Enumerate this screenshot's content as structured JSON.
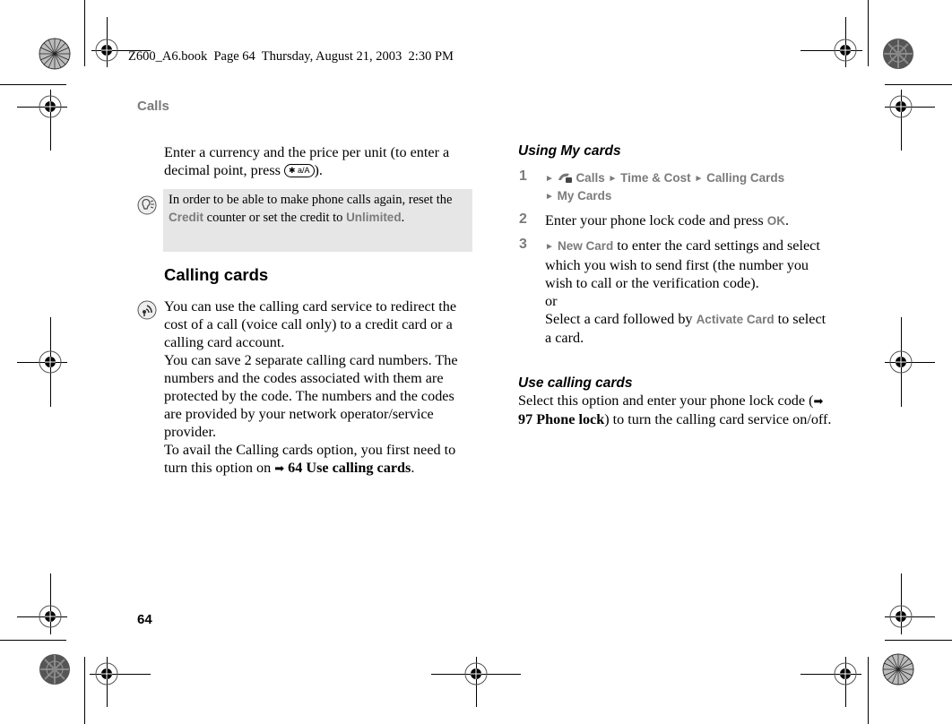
{
  "header": {
    "slug": "Z600_A6.book  Page 64  Thursday, August 21, 2003  2:30 PM",
    "running_head": "Calls"
  },
  "footer": {
    "page_number": "64"
  },
  "left_column": {
    "intro": {
      "text_before_key": "Enter a currency and the price per unit (to enter a decimal point, press ",
      "key_label": "✱ a/A",
      "text_after_key": ")."
    },
    "note": {
      "icon": "lightbulb-tip-icon",
      "text_1": "In order to be able to make phone calls again, reset the ",
      "menu_1": "Credit",
      "text_2": " counter or set the credit to ",
      "menu_2": "Unlimited",
      "text_3": "."
    },
    "heading": "Calling cards",
    "service": {
      "icon": "network-service-icon",
      "text_1": "You can use the calling card service to redirect the cost of a call (voice call only) to a credit card or a calling card account.",
      "text_2": "You can save 2 separate calling card numbers. The numbers and the codes associated with them are protected by the code. The numbers and the codes are provided by your network operator/service provider.",
      "text_3": "To avail the Calling cards option, you first need to turn this option on ",
      "xref_arrow": "➡",
      "xref": "64 Use calling cards",
      "text_4": "."
    }
  },
  "right_column": {
    "heading_using": "Using My cards",
    "steps": [
      {
        "number": "1",
        "path": [
          "Calls",
          "Time & Cost",
          "Calling Cards",
          "My Cards"
        ],
        "path_icon": "calls-phone-icon"
      },
      {
        "number": "2",
        "text_1": "Enter your phone lock code and press ",
        "menu": "OK",
        "text_2": "."
      },
      {
        "number": "3",
        "menu_1": "New Card",
        "text_1": " to enter the card settings and select which you wish to send first (the number you wish to call or the verification code).",
        "or": "or",
        "text_2": "Select a card followed by ",
        "menu_2": "Activate Card",
        "text_3": " to select a card."
      }
    ],
    "heading_use": "Use calling cards",
    "use": {
      "text_1": "Select this option and enter your phone lock code (",
      "xref_arrow": "➡",
      "xref": "97 Phone lock",
      "text_2": ") to turn the calling card service on/off."
    }
  },
  "triangle": "►"
}
